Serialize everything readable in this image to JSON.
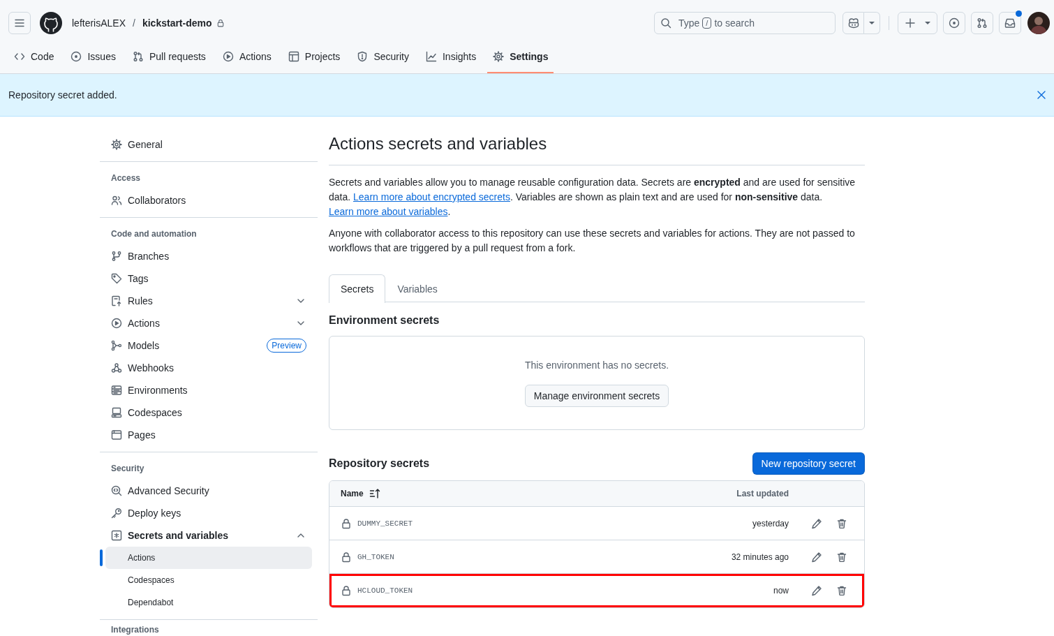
{
  "header": {
    "owner": "lefterisALEX",
    "separator": "/",
    "repo": "kickstart-demo",
    "private": true,
    "search": {
      "placeholder_start": "Type",
      "shortcut_key": "/",
      "placeholder_end": "to search"
    },
    "unread_notifications": true
  },
  "repo_nav": [
    {
      "label": "Code",
      "selected": false
    },
    {
      "label": "Issues",
      "selected": false
    },
    {
      "label": "Pull requests",
      "selected": false
    },
    {
      "label": "Actions",
      "selected": false
    },
    {
      "label": "Projects",
      "selected": false
    },
    {
      "label": "Security",
      "selected": false
    },
    {
      "label": "Insights",
      "selected": false
    },
    {
      "label": "Settings",
      "selected": true
    }
  ],
  "flash": {
    "message": "Repository secret added.",
    "dismissible": true
  },
  "sidebar": {
    "sections": [
      {
        "items": [
          {
            "kind": "link",
            "label": "General",
            "selected": false
          }
        ]
      },
      {
        "heading": "Access",
        "items": [
          {
            "kind": "link",
            "label": "Collaborators",
            "selected": false
          }
        ]
      },
      {
        "heading": "Code and automation",
        "items": [
          {
            "kind": "link",
            "label": "Branches",
            "selected": false
          },
          {
            "kind": "link",
            "label": "Tags",
            "selected": false
          },
          {
            "kind": "group",
            "label": "Rules",
            "selected": false,
            "expanded": false
          },
          {
            "kind": "group",
            "label": "Actions",
            "selected": false,
            "expanded": false
          },
          {
            "kind": "link",
            "label": "Models",
            "selected": false,
            "badge": "Preview"
          },
          {
            "kind": "link",
            "label": "Webhooks",
            "selected": false
          },
          {
            "kind": "link",
            "label": "Environments",
            "selected": false
          },
          {
            "kind": "link",
            "label": "Codespaces",
            "selected": false
          },
          {
            "kind": "link",
            "label": "Pages",
            "selected": false
          }
        ]
      },
      {
        "heading": "Security",
        "items": [
          {
            "kind": "link",
            "label": "Advanced Security",
            "selected": false
          },
          {
            "kind": "link",
            "label": "Deploy keys",
            "selected": false
          },
          {
            "kind": "group",
            "label": "Secrets and variables",
            "selected": false,
            "expanded": true,
            "children": [
              {
                "label": "Actions",
                "selected": true
              },
              {
                "label": "Codespaces",
                "selected": false
              },
              {
                "label": "Dependabot",
                "selected": false
              }
            ]
          }
        ]
      },
      {
        "heading": "Integrations"
      }
    ]
  },
  "page": {
    "title": "Actions secrets and variables",
    "paragraphs": [
      {
        "segments": [
          {
            "kind": "text",
            "text": "Secrets and variables allow you to manage reusable configuration data. Secrets are **encrypted** and are used for sensitive data. "
          },
          {
            "kind": "link",
            "text": "Learn more about encrypted secrets"
          },
          {
            "kind": "text",
            "text": ". Variables are shown as plain text and are used for **non-sensitive** data. "
          },
          {
            "kind": "link",
            "text": "Learn more about variables"
          },
          {
            "kind": "text",
            "text": "."
          }
        ]
      },
      {
        "segments": [
          {
            "kind": "text",
            "text": "Anyone with collaborator access to this repository can use these secrets and variables for actions. They are not passed to workflows that are triggered by a pull request from a fork."
          }
        ]
      }
    ],
    "tabs": [
      {
        "label": "Secrets",
        "selected": true
      },
      {
        "label": "Variables",
        "selected": false
      }
    ],
    "environment_secrets": {
      "heading": "Environment secrets",
      "empty_message": "This environment has no secrets.",
      "button": "Manage environment secrets"
    },
    "repository_secrets": {
      "heading": "Repository secrets",
      "new_button": "New repository secret",
      "columns": [
        {
          "label": "Name",
          "sorted": true
        },
        {
          "label": "Last updated",
          "sorted": false
        }
      ],
      "rows": [
        {
          "name": "DUMMY_SECRET",
          "updated": "yesterday",
          "highlighted": false
        },
        {
          "name": "GH_TOKEN",
          "updated": "32 minutes ago",
          "highlighted": false
        },
        {
          "name": "HCLOUD_TOKEN",
          "updated": "now",
          "highlighted": true
        }
      ]
    }
  }
}
